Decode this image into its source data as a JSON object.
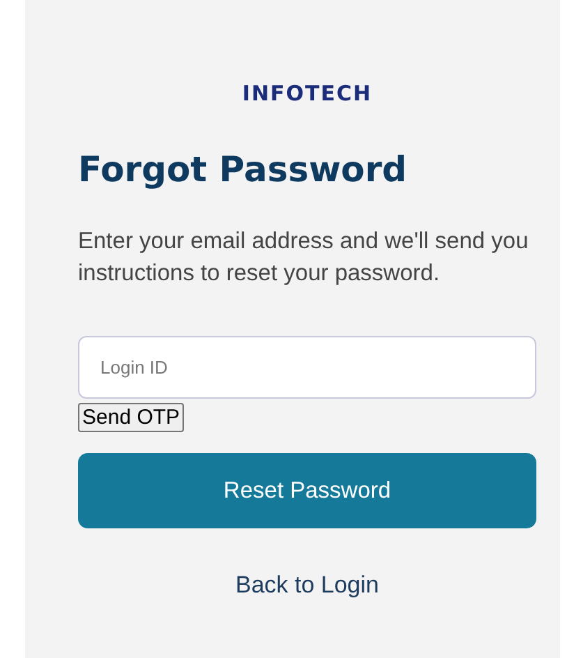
{
  "logo": "INFOTECH",
  "title": "Forgot Password",
  "description": "Enter your email address and we'll send you instructions to reset your password.",
  "login_field": {
    "placeholder": "Login ID"
  },
  "send_otp_button": "Send OTP",
  "reset_button": "Reset Password",
  "back_link": "Back to Login"
}
